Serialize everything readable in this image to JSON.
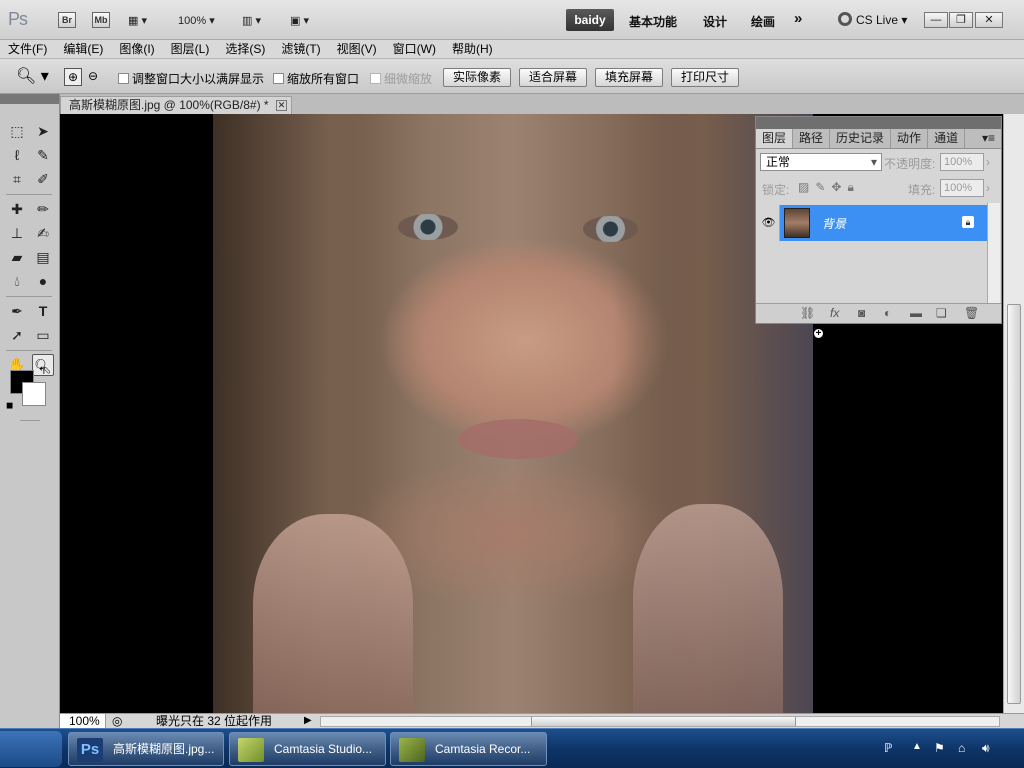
{
  "app": {
    "logo": "Ps",
    "bridge": "Br",
    "minibridge": "Mb",
    "zoom": "100%",
    "workspace_active": "baidy",
    "workspaces": [
      "基本功能",
      "设计",
      "绘画"
    ],
    "more": "»",
    "cslive": "CS Live"
  },
  "menu": [
    "文件(F)",
    "编辑(E)",
    "图像(I)",
    "图层(L)",
    "选择(S)",
    "滤镜(T)",
    "视图(V)",
    "窗口(W)",
    "帮助(H)"
  ],
  "options": {
    "resize_windows": "调整窗口大小以满屏显示",
    "zoom_all": "缩放所有窗口",
    "scrubby": "细微缩放",
    "actual_pixels": "实际像素",
    "fit_screen": "适合屏幕",
    "fill_screen": "填充屏幕",
    "print_size": "打印尺寸"
  },
  "document": {
    "tab_title": "高斯模糊原图.jpg @ 100%(RGB/8#) *"
  },
  "layers_panel": {
    "tabs": [
      "图层",
      "路径",
      "历史记录",
      "动作",
      "通道"
    ],
    "blend_mode": "正常",
    "opacity_label": "不透明度:",
    "opacity_value": "100%",
    "lock_label": "锁定:",
    "fill_label": "填充:",
    "fill_value": "100%",
    "layer_name": "背景"
  },
  "status": {
    "zoom": "100%",
    "message": "曝光只在 32 位起作用"
  },
  "taskbar": {
    "items": [
      "高斯模糊原图.jpg...",
      "Camtasia Studio...",
      "Camtasia Recor..."
    ]
  }
}
